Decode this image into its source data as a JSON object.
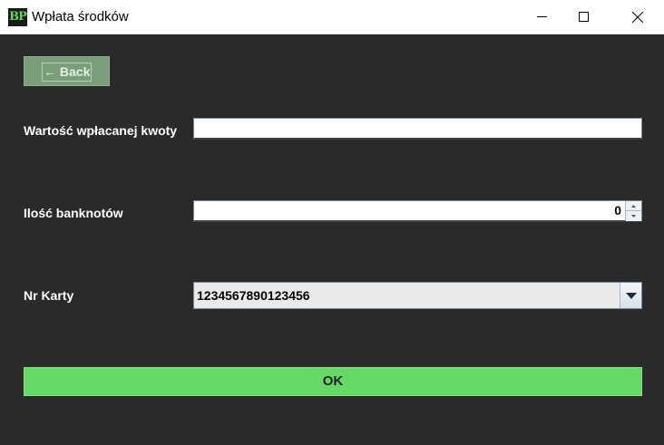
{
  "window": {
    "title": "Wpłata środków",
    "app_icon_text": "BP"
  },
  "back_button": {
    "label": "← Back"
  },
  "form": {
    "amount": {
      "label": "Wartość wpłacanej kwoty",
      "value": ""
    },
    "banknotes": {
      "label": "Ilość banknotów",
      "value": "0"
    },
    "card": {
      "label": "Nr Karty",
      "selected": "1234567890123456"
    }
  },
  "ok_button": {
    "label": "OK"
  },
  "colors": {
    "background": "#2a2a2a",
    "ok_green": "#65d865",
    "back_green": "#7a9e7a"
  }
}
